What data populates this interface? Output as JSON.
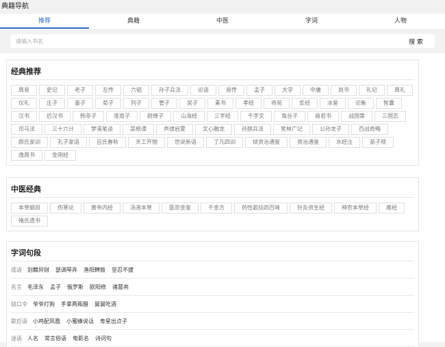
{
  "window": {
    "title": "典籍导航"
  },
  "tabs": [
    {
      "label": "推荐",
      "active": true
    },
    {
      "label": "典籍"
    },
    {
      "label": "中医"
    },
    {
      "label": "字词"
    },
    {
      "label": "人物"
    }
  ],
  "search": {
    "placeholder": "请输入书名",
    "value": "",
    "button_label": "搜 索"
  },
  "classics": {
    "title": "经典推荐",
    "tags": [
      "周易",
      "史记",
      "老子",
      "左传",
      "六韬",
      "孙子兵法",
      "论语",
      "易传",
      "孟子",
      "大学",
      "中庸",
      "尚书",
      "礼记",
      "周礼",
      "仪礼",
      "庄子",
      "墨子",
      "荀子",
      "列子",
      "管子",
      "吴子",
      "素书",
      "孝经",
      "将苑",
      "反经",
      "冰鉴",
      "论衡",
      "智囊",
      "汉书",
      "后汉书",
      "韩非子",
      "淮南子",
      "尉缭子",
      "山海经",
      "三字经",
      "千字文",
      "鬼谷子",
      "商君书",
      "战国策",
      "三国志",
      "司马法",
      "三十六计",
      "梦溪笔谈",
      "菜根谭",
      "声律启蒙",
      "文心雕龙",
      "孙膑兵法",
      "笑林广记",
      "公孙龙子",
      "百战奇略",
      "颜氏家训",
      "孔子家语",
      "吕氏春秋",
      "天工开物",
      "世说新语",
      "了凡四训",
      "续资治通鉴",
      "资治通鉴",
      "水经注",
      "弟子规",
      "逸周书",
      "金刚经"
    ]
  },
  "tcm": {
    "title": "中医经典",
    "tags": [
      "本草纲目",
      "伤寒论",
      "黄帝内经",
      "汤液本草",
      "医宗金鉴",
      "千金方",
      "药性歌括四百味",
      "针灸资生经",
      "神农本草经",
      "难经",
      "褚氏遗书"
    ]
  },
  "phrases": {
    "title": "字词句段",
    "rows": [
      {
        "category": "成语",
        "items": [
          "别籍异财",
          "瑟调琴弄",
          "渔阳鞞鼓",
          "坚忍不拔"
        ]
      },
      {
        "category": "名言",
        "items": [
          "毛泽东",
          "孟子",
          "俄罗斯",
          "欧阳修",
          "诸葛亮"
        ]
      },
      {
        "category": "绕口令",
        "items": [
          "爷爷打狗",
          "手拿两瓶醋",
          "舅舅吃酒"
        ]
      },
      {
        "category": "歇后语",
        "items": [
          "小鸡配凤凰",
          "小蜜蜂说话",
          "寿星出点子"
        ]
      },
      {
        "category": "谜语",
        "items": [
          "人名",
          "常言俗语",
          "电影名",
          "诗词句"
        ]
      }
    ]
  }
}
